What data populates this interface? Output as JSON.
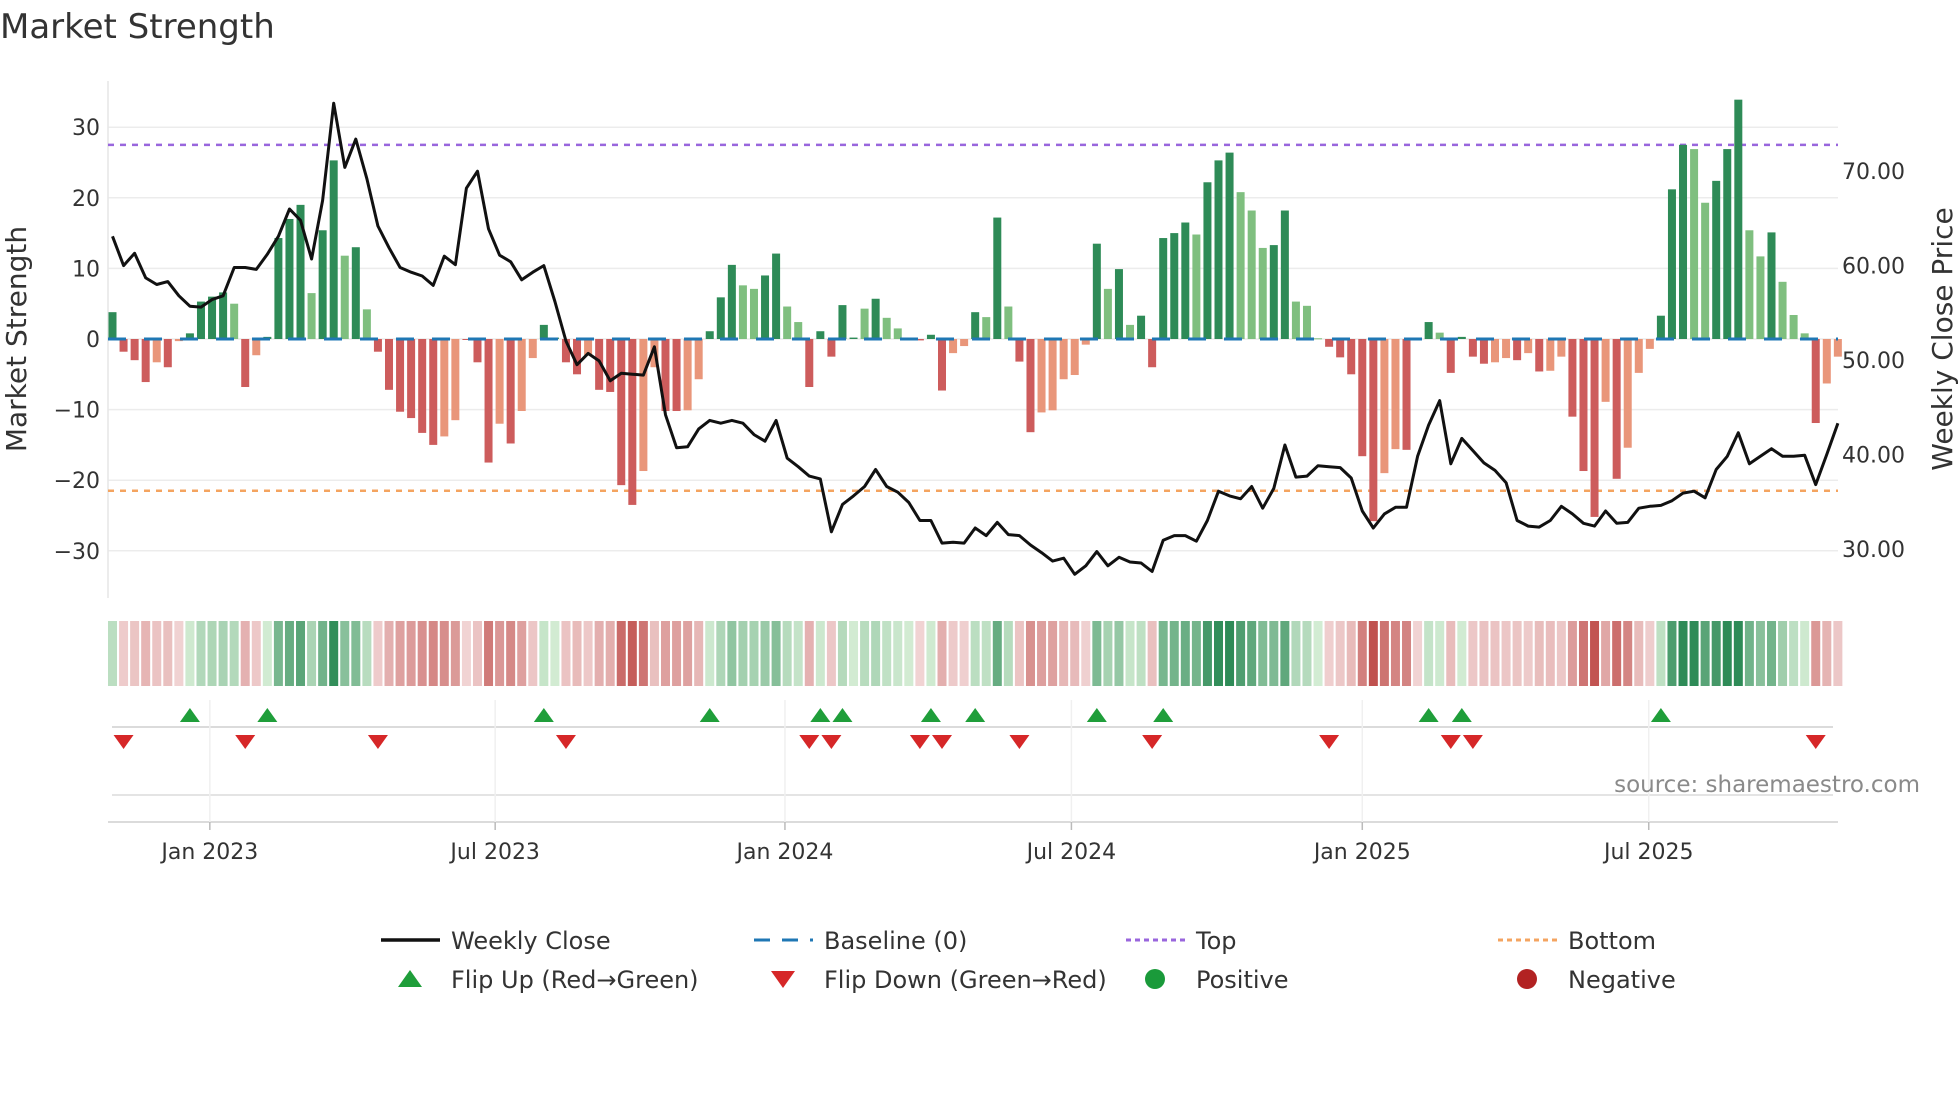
{
  "chart_data": {
    "type": "bar",
    "title": "Market Strength",
    "ylabel": "Market Strength",
    "ylabel_right": "Weekly Close Price",
    "ylim": [
      -37,
      37
    ],
    "ylim_right": [
      24,
      81
    ],
    "yticks": [
      30,
      20,
      10,
      0,
      -10,
      -20,
      -30
    ],
    "yticks_labels": [
      "30",
      "20",
      "10",
      "0",
      "−10",
      "−20",
      "−30"
    ],
    "yticks_right": [
      70,
      60,
      50,
      40,
      30
    ],
    "yticks_right_labels": [
      "70.00",
      "60.00",
      "50.00",
      "40.00",
      "30.00"
    ],
    "xticks": [
      {
        "week": 8.8,
        "label": "Jan 2023"
      },
      {
        "week": 34.6,
        "label": "Jul 2023"
      },
      {
        "week": 60.8,
        "label": "Jan 2024"
      },
      {
        "week": 86.7,
        "label": "Jul 2024"
      },
      {
        "week": 113.0,
        "label": "Jan 2025"
      },
      {
        "week": 138.9,
        "label": "Jul 2025"
      }
    ],
    "top_level": 27.5,
    "bottom_level": -21.5,
    "baseline": 0,
    "strength": [
      3.8,
      -1.8,
      -3,
      -6.1,
      -3.3,
      -4,
      -0.3,
      0.8,
      5.3,
      6,
      6.6,
      5,
      -6.8,
      -2.3,
      0.3,
      14.3,
      17,
      19,
      6.5,
      15.4,
      25.3,
      11.8,
      13,
      4.2,
      -1.8,
      -7.2,
      -10.3,
      -11.2,
      -13.3,
      -15,
      -13.8,
      -11.5,
      -0.1,
      -3.3,
      -17.5,
      -12,
      -14.8,
      -10.2,
      -2.7,
      2,
      0.2,
      -3.3,
      -5,
      -2.3,
      -7.2,
      -7.5,
      -20.7,
      -23.5,
      -18.7,
      -4,
      -10.2,
      -10.2,
      -10.1,
      -5.7,
      1.1,
      5.9,
      10.5,
      7.6,
      7.1,
      9,
      12.1,
      4.6,
      2.4,
      -6.8,
      1.1,
      -2.5,
      4.8,
      0.2,
      4.3,
      5.7,
      3,
      1.5,
      0.2,
      -0.2,
      0.6,
      -7.3,
      -2,
      -1,
      3.8,
      3.1,
      17.2,
      4.6,
      -3.2,
      -13.2,
      -10.4,
      -10.1,
      -5.7,
      -5.1,
      -0.8,
      13.5,
      7.1,
      9.9,
      2,
      3.3,
      -4,
      14.3,
      15,
      16.5,
      14.8,
      22.2,
      25.3,
      26.4,
      20.8,
      18.2,
      12.9,
      13.3,
      18.2,
      5.3,
      4.7,
      0.1,
      -1.1,
      -2.6,
      -5,
      -16.6,
      -25.8,
      -19,
      -15.6,
      -15.7,
      -0.2,
      2.4,
      0.9,
      -4.8,
      0.3,
      -2.5,
      -3.5,
      -3.3,
      -2.7,
      -3,
      -2,
      -4.6,
      -4.5,
      -2.5,
      -11,
      -18.7,
      -25.2,
      -8.9,
      -19.8,
      -15.4,
      -4.8,
      -1.4,
      3.3,
      21.2,
      27.5,
      26.9,
      19.3,
      22.4,
      26.9,
      33.9,
      15.4,
      11.7,
      15.1,
      8.1,
      3.4,
      0.8,
      -11.9,
      -6.3,
      -2.5
    ],
    "strengthening": [
      1,
      1,
      1,
      1,
      0,
      1,
      0,
      1,
      1,
      1,
      1,
      0,
      1,
      0,
      1,
      1,
      1,
      1,
      0,
      1,
      1,
      0,
      1,
      0,
      1,
      1,
      1,
      1,
      1,
      1,
      0,
      0,
      1,
      1,
      1,
      0,
      1,
      0,
      0,
      1,
      1,
      1,
      1,
      0,
      1,
      1,
      1,
      1,
      0,
      0,
      1,
      1,
      0,
      0,
      1,
      1,
      1,
      0,
      0,
      1,
      1,
      0,
      0,
      1,
      1,
      1,
      1,
      1,
      0,
      1,
      0,
      0,
      0,
      1,
      1,
      1,
      0,
      0,
      1,
      0,
      1,
      0,
      1,
      1,
      0,
      0,
      0,
      0,
      0,
      1,
      0,
      1,
      0,
      1,
      1,
      1,
      1,
      1,
      0,
      1,
      1,
      1,
      0,
      0,
      0,
      1,
      1,
      0,
      0,
      0,
      1,
      1,
      1,
      1,
      1,
      0,
      0,
      1,
      1,
      1,
      0,
      1,
      1,
      1,
      1,
      0,
      0,
      1,
      0,
      1,
      0,
      0,
      1,
      1,
      1,
      0,
      1,
      0,
      0,
      0,
      1,
      1,
      1,
      0,
      0,
      1,
      1,
      1,
      0,
      0,
      1,
      0,
      0,
      0,
      1,
      0,
      0
    ],
    "weekly_close": [
      63.1,
      60.0,
      61.3,
      58.7,
      58.0,
      58.3,
      56.8,
      55.7,
      55.6,
      56.4,
      56.8,
      59.8,
      59.8,
      59.6,
      61.2,
      63.1,
      66.0,
      64.8,
      60.7,
      66.9,
      77.2,
      70.4,
      73.4,
      69.2,
      64.2,
      61.9,
      59.8,
      59.3,
      58.9,
      57.9,
      61.0,
      60.1,
      68.2,
      70.0,
      63.9,
      61.1,
      60.4,
      58.5,
      59.3,
      60.0,
      56.2,
      52.0,
      49.5,
      50.7,
      49.9,
      47.8,
      48.6,
      48.5,
      48.4,
      51.4,
      44.2,
      40.7,
      40.8,
      42.7,
      43.6,
      43.3,
      43.6,
      43.3,
      42.1,
      41.4,
      43.6,
      39.6,
      38.7,
      37.7,
      37.4,
      31.8,
      34.7,
      35.6,
      36.6,
      38.4,
      36.6,
      36.0,
      34.9,
      33.0,
      33.0,
      30.6,
      30.7,
      30.6,
      32.2,
      31.4,
      32.8,
      31.5,
      31.4,
      30.4,
      29.6,
      28.7,
      29.0,
      27.3,
      28.2,
      29.7,
      28.2,
      29.1,
      28.6,
      28.5,
      27.6,
      30.9,
      31.4,
      31.4,
      30.8,
      33.0,
      36.1,
      35.6,
      35.3,
      36.6,
      34.3,
      36.4,
      41.0,
      37.6,
      37.7,
      38.8,
      38.7,
      38.6,
      37.5,
      34.0,
      32.2,
      33.7,
      34.4,
      34.4,
      39.8,
      43.1,
      45.7,
      39.0,
      41.7,
      40.4,
      39.1,
      38.3,
      37.0,
      33.0,
      32.4,
      32.3,
      33.0,
      34.5,
      33.7,
      32.7,
      32.4,
      34.0,
      32.7,
      32.8,
      34.3,
      34.5,
      34.6,
      35.1,
      35.9,
      36.1,
      35.4,
      38.4,
      39.8,
      42.3,
      39.0,
      39.8,
      40.6,
      39.8,
      39.8,
      39.9,
      36.8,
      40.0,
      43.3
    ],
    "flip_up_weeks": [
      8,
      15,
      40,
      55,
      65,
      67,
      75,
      79,
      90,
      96,
      120,
      123,
      141
    ],
    "flip_down_weeks": [
      2,
      13,
      25,
      42,
      64,
      66,
      74,
      76,
      83,
      95,
      111,
      122,
      124,
      155
    ],
    "legend": [
      {
        "label": "Weekly Close",
        "kind": "line"
      },
      {
        "label": "Baseline (0)",
        "kind": "dashed"
      },
      {
        "label": "Top",
        "kind": "dotted-top"
      },
      {
        "label": "Bottom",
        "kind": "dotted-bottom"
      },
      {
        "label": "Flip Up (Red→Green)",
        "kind": "tri-up"
      },
      {
        "label": "Flip Down (Green→Red)",
        "kind": "tri-down"
      },
      {
        "label": "Positive",
        "kind": "dot-pos"
      },
      {
        "label": "Negative",
        "kind": "dot-neg"
      }
    ],
    "legend_position": "bottom",
    "grid": true
  },
  "source": "source: sharemaestro.com",
  "colors": {
    "strong_pos": "#2e8b57",
    "weak_pos": "#7fbf7f",
    "strong_neg": "#cd5c5c",
    "weak_neg": "#e9967a",
    "close": "#111111",
    "baseline": "#1f77b4",
    "top": "#9966dd",
    "bottom": "#f4a460",
    "flip_up": "#1f9e3a",
    "flip_down": "#d62728",
    "pos_dot": "#1a9a3a",
    "neg_dot": "#b22222"
  }
}
